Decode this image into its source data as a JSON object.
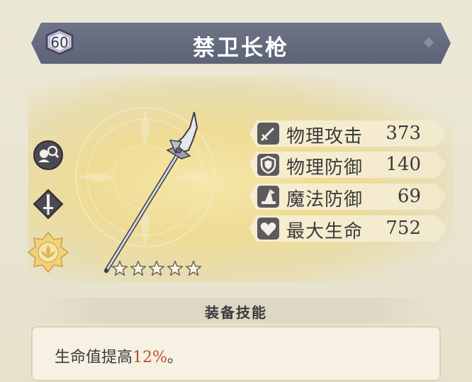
{
  "item": {
    "level": "60",
    "name": "禁卫长枪",
    "rarity_stars": 5
  },
  "stats": [
    {
      "icon": "sword-icon",
      "label": "物理攻击",
      "value": "373"
    },
    {
      "icon": "shield-icon",
      "label": "物理防御",
      "value": "140"
    },
    {
      "icon": "wizard-hat-icon",
      "label": "魔法防御",
      "value": "69"
    },
    {
      "icon": "heart-icon",
      "label": "最大生命",
      "value": "752"
    }
  ],
  "skill": {
    "title": "装备技能",
    "text_before": "生命值提高",
    "highlight": "12%",
    "text_after": "。"
  },
  "colors": {
    "header": "#5c6376",
    "highlight": "#b5532e",
    "stat_icon_bg": "#5b5b5e"
  }
}
